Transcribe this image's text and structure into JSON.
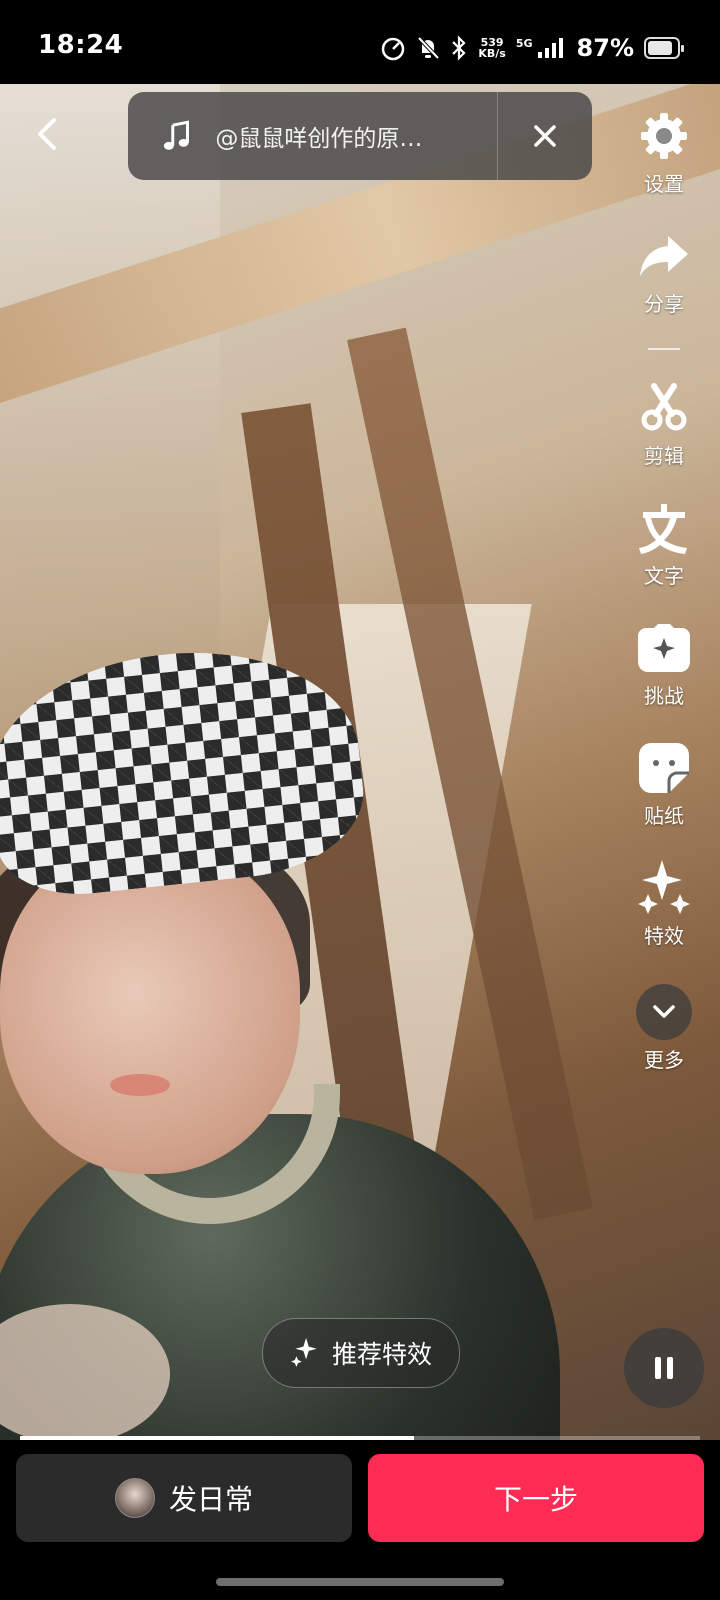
{
  "status_bar": {
    "time": "18:24",
    "net_speed_value": "539",
    "net_speed_unit": "KB/s",
    "network_type": "5G",
    "battery_percent": "87%",
    "battery_level": 0.87
  },
  "music": {
    "title": "@鼠鼠咩创作的原…"
  },
  "tools": [
    {
      "label": "设置",
      "icon": "gear-icon"
    },
    {
      "label": "分享",
      "icon": "share-arrow-icon"
    },
    {
      "label": "剪辑",
      "icon": "scissors-icon"
    },
    {
      "label": "文字",
      "icon": "text-icon"
    },
    {
      "label": "挑战",
      "icon": "challenge-icon"
    },
    {
      "label": "贴纸",
      "icon": "sticker-icon"
    },
    {
      "label": "特效",
      "icon": "sparkles-icon"
    },
    {
      "label": "更多",
      "icon": "chevron-down-icon"
    }
  ],
  "effects_button": {
    "label": "推荐特效"
  },
  "progress": {
    "fraction": 0.58
  },
  "bottom": {
    "daily_label": "发日常",
    "next_label": "下一步"
  },
  "colors": {
    "accent": "#fe2c55"
  }
}
